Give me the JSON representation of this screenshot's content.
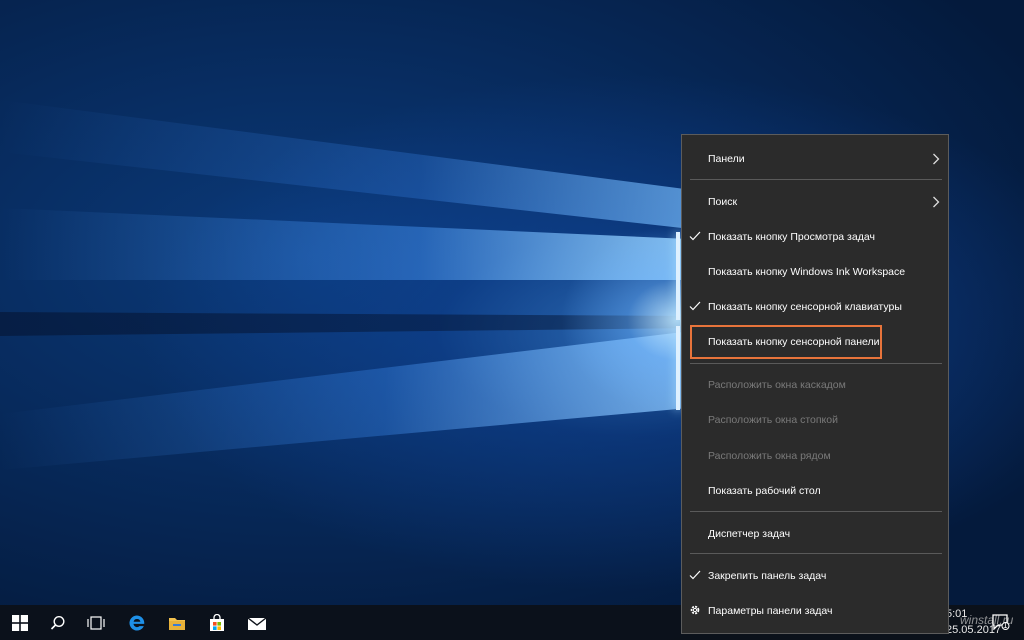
{
  "menu": {
    "items": [
      {
        "label": "Панели",
        "submenu": true
      },
      {
        "label": "Поиск",
        "submenu": true
      },
      {
        "label": "Показать кнопку Просмотра задач",
        "checked": true
      },
      {
        "label": "Показать кнопку Windows Ink Workspace"
      },
      {
        "label": "Показать кнопку сенсорной клавиатуры",
        "checked": true
      },
      {
        "label": "Показать кнопку сенсорной панели",
        "highlighted": true
      },
      {
        "label": "Расположить окна каскадом",
        "disabled": true
      },
      {
        "label": "Расположить окна стопкой",
        "disabled": true
      },
      {
        "label": "Расположить окна рядом",
        "disabled": true
      },
      {
        "label": "Показать рабочий стол"
      },
      {
        "label": "Диспетчер задач"
      },
      {
        "label": "Закрепить панель задач",
        "checked": true
      },
      {
        "label": "Параметры панели задач",
        "icon": "gear-icon"
      }
    ]
  },
  "taskbar": {
    "icons": [
      "windows-start-icon",
      "search-icon",
      "task-view-icon",
      "edge-browser-icon",
      "file-explorer-icon",
      "store-icon",
      "mail-icon"
    ]
  },
  "tray": {
    "time": "5:01",
    "date": "25.05.2017",
    "watermark": "winstall.ru",
    "notification_count": "1"
  },
  "colors": {
    "menu_bg": "#2b2b2b",
    "highlight_border": "#e8743b",
    "edge_blue": "#1e90e8",
    "explorer_yellow": "#f2c14e"
  }
}
